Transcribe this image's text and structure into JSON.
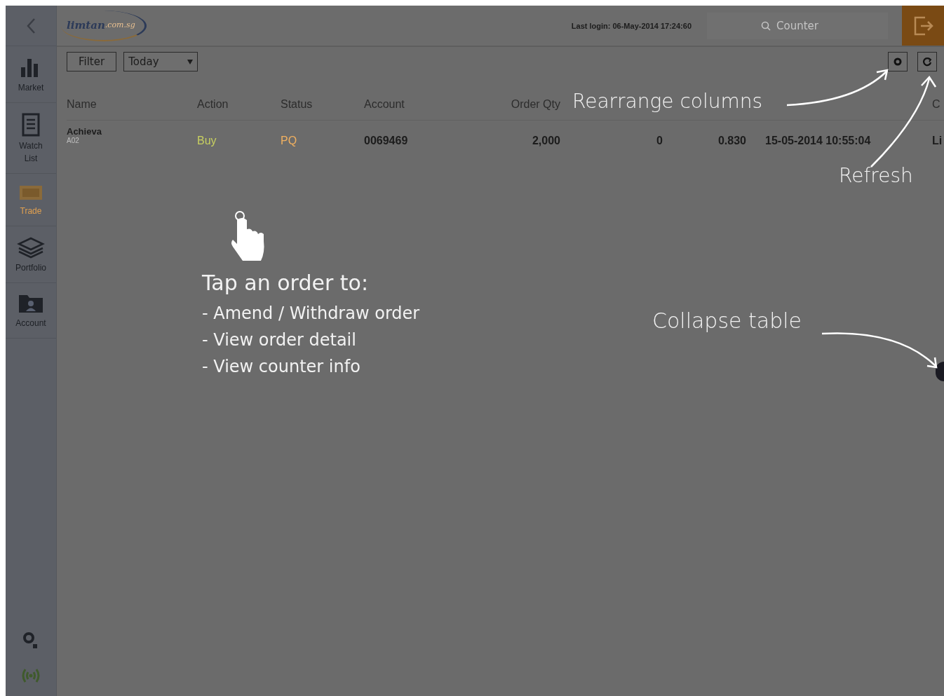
{
  "header": {
    "logo_text": "limtan",
    "logo_suffix": ".com.sg",
    "last_login": "Last login: 06-May-2014 17:24:60",
    "search": {
      "placeholder": "Counter"
    }
  },
  "sidebar": {
    "items": [
      {
        "label": "Market",
        "kind": "chart",
        "selected": false
      },
      {
        "label": "Watch List",
        "kind": "list",
        "selected": false
      },
      {
        "label": "Trade",
        "kind": "trade",
        "selected": true
      },
      {
        "label": "Portfolio",
        "kind": "stack",
        "selected": false
      },
      {
        "label": "Account",
        "kind": "folder",
        "selected": false
      }
    ]
  },
  "toolbar": {
    "filter": "Filter",
    "period": "Today"
  },
  "table": {
    "columns": [
      "Name",
      "Action",
      "Status",
      "Account",
      "Order Qty",
      "C"
    ],
    "rows": [
      {
        "name": "Achieva",
        "code": "A02",
        "action": "Buy",
        "status": "PQ",
        "account": "0069469",
        "order_qty": "2,000",
        "column_6": "0",
        "column_7": "0.830",
        "column_8": "15-05-2014 10:55:04",
        "column_9": "Li"
      }
    ]
  },
  "annotations": {
    "rearrange": "Rearrange columns",
    "refresh": "Refresh",
    "tap_title": "Tap an order to:",
    "tap_items": [
      "- Amend / Withdraw order",
      "- View order detail",
      "- View counter info"
    ],
    "collapse": "Collapse table"
  }
}
